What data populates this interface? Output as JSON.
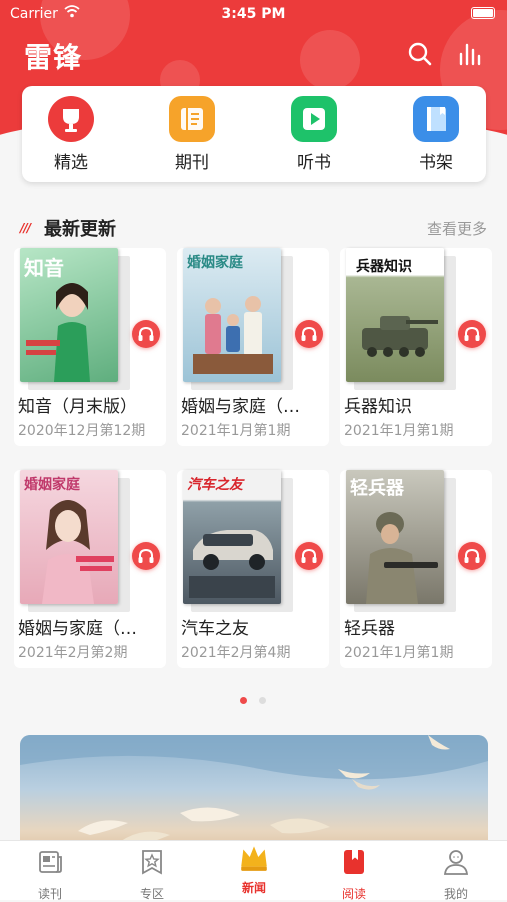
{
  "status_bar": {
    "carrier": "Carrier",
    "time": "3:45 PM"
  },
  "header": {
    "title": "雷锋"
  },
  "categories": [
    {
      "label": "精选",
      "icon": "trophy-icon",
      "color": "#ec3b3b"
    },
    {
      "label": "期刊",
      "icon": "book-open-icon",
      "color": "#f6a32a"
    },
    {
      "label": "听书",
      "icon": "play-icon",
      "color": "#1ec26a"
    },
    {
      "label": "书架",
      "icon": "bookshelf-icon",
      "color": "#3b8ee8"
    }
  ],
  "section": {
    "title": "最新更新",
    "more": "查看更多"
  },
  "magazines": [
    {
      "name": "知音（月末版）",
      "issue": "2020年12月第12期",
      "masthead": "知音",
      "cover_color": "#8fd0a6"
    },
    {
      "name": "婚姻与家庭（…",
      "issue": "2021年1月第1期",
      "masthead": "婚姻家庭",
      "cover_color": "#c7dbe6"
    },
    {
      "name": "兵器知识",
      "issue": "2021年1月第1期",
      "masthead": "兵器知识",
      "cover_color": "#8e9d79"
    },
    {
      "name": "婚姻与家庭（…",
      "issue": "2021年2月第2期",
      "masthead": "婚姻家庭",
      "cover_color": "#e9b7c4"
    },
    {
      "name": "汽车之友",
      "issue": "2021年2月第4期",
      "masthead": "汽车之友",
      "cover_color": "#6c7a86"
    },
    {
      "name": "轻兵器",
      "issue": "2021年1月第1期",
      "masthead": "轻兵器",
      "cover_color": "#8d8a7a"
    }
  ],
  "pager": {
    "active_index": 0,
    "count": 2,
    "active_color": "#ef4a4a",
    "inactive_color": "#dddddd"
  },
  "tabbar": [
    {
      "label": "读刊",
      "icon": "newspaper-icon",
      "active": false
    },
    {
      "label": "专区",
      "icon": "star-badge-icon",
      "active": false
    },
    {
      "label": "新闻",
      "icon": "crown-icon",
      "active": false
    },
    {
      "label": "阅读",
      "icon": "bookmark-book-icon",
      "active": true
    },
    {
      "label": "我的",
      "icon": "profile-icon",
      "active": false
    }
  ],
  "colors": {
    "brand_red": "#ec3b3b",
    "accent_red": "#e8322d"
  }
}
